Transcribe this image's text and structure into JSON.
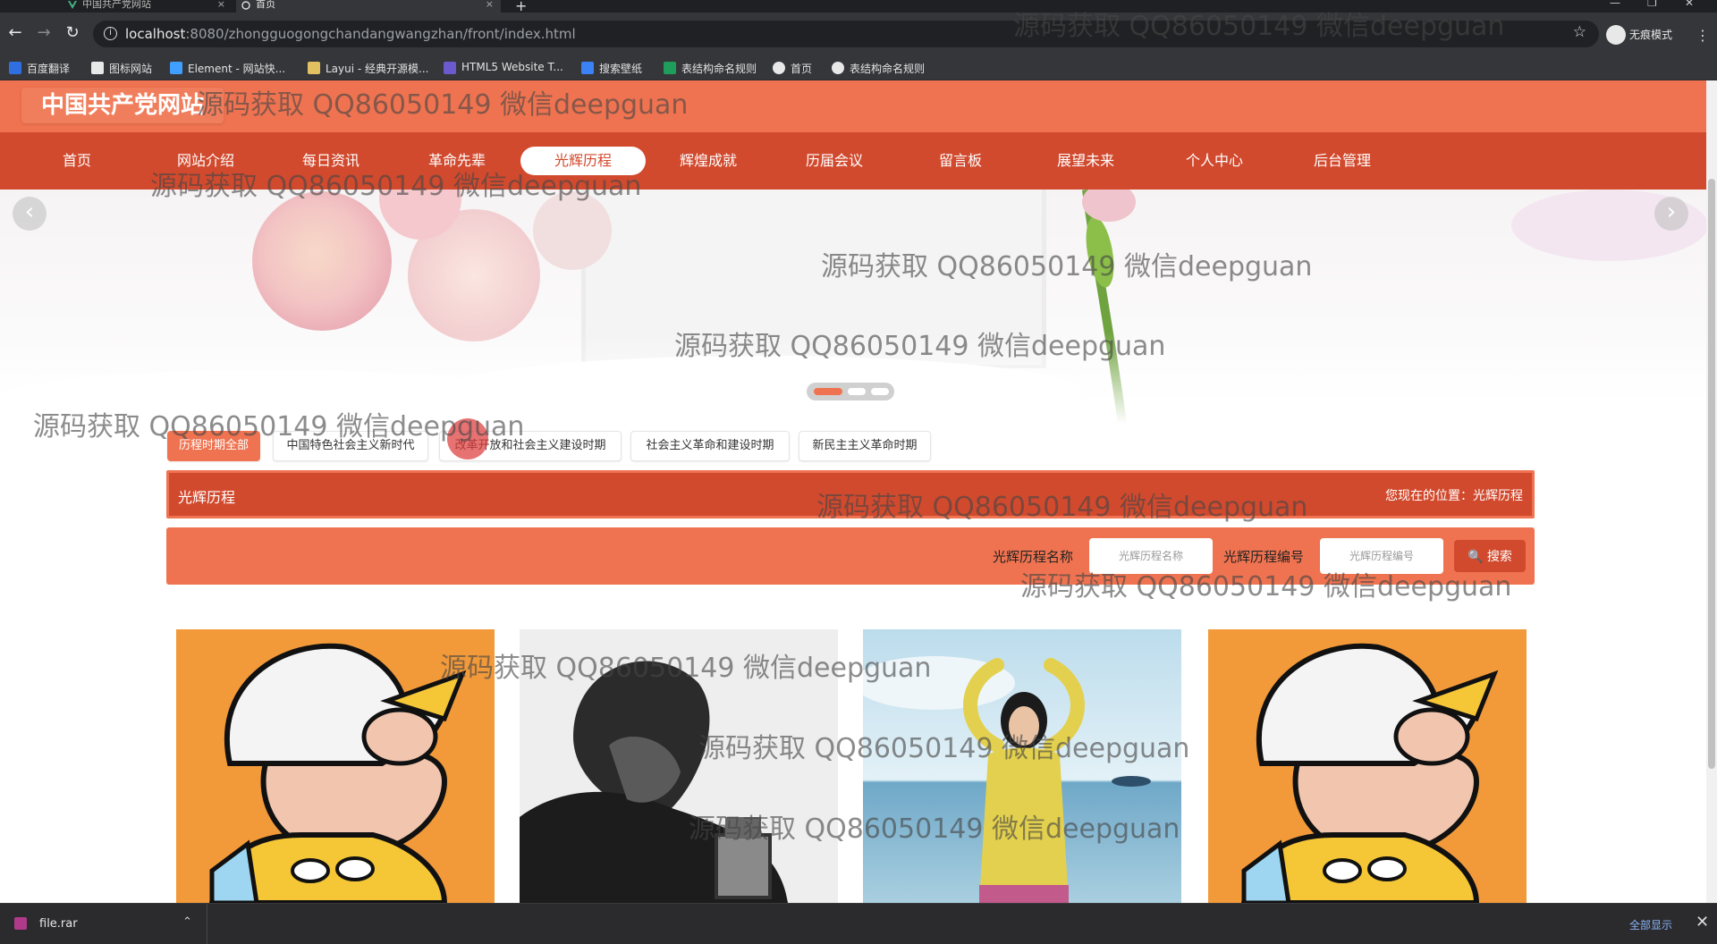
{
  "browser": {
    "tabs": [
      {
        "title": "中国共产党网站",
        "close": "×"
      },
      {
        "title": "首页",
        "close": "×"
      }
    ],
    "new_tab": "+",
    "url_host": "localhost",
    "url_path": ":8080/zhongguogongchandangwangzhan/front/index.html",
    "profile_label": "无痕模式",
    "bookmarks": [
      {
        "label": "百度翻译",
        "icon": "baidu-translate-icon",
        "color": "#2f6fe0"
      },
      {
        "label": "图标网站",
        "icon": "flag-icon",
        "color": "#e8e8e8"
      },
      {
        "label": "Element - 网站快...",
        "icon": "element-icon",
        "color": "#409eff"
      },
      {
        "label": "Layui - 经典开源模...",
        "icon": "layui-icon",
        "color": "#e0c060"
      },
      {
        "label": "HTML5 Website T...",
        "icon": "html5-template-icon",
        "color": "#6a5acd"
      },
      {
        "label": "搜索壁纸",
        "icon": "wallpaper-search-icon",
        "color": "#3b82f6"
      },
      {
        "label": "表结构命名规则",
        "icon": "sheet-icon",
        "color": "#1e9e5a"
      },
      {
        "label": "首页",
        "icon": "globe-icon",
        "color": "#e8e8e8"
      },
      {
        "label": "表结构命名规则",
        "icon": "globe-icon",
        "color": "#e8e8e8"
      }
    ],
    "downloads": {
      "file": "file.rar",
      "show_all": "全部显示",
      "close": "✕"
    }
  },
  "site": {
    "title": "中国共产党网站",
    "nav": [
      {
        "label": "首页",
        "active": false
      },
      {
        "label": "网站介绍",
        "active": false
      },
      {
        "label": "每日资讯",
        "active": false
      },
      {
        "label": "革命先辈",
        "active": false
      },
      {
        "label": "光辉历程",
        "active": true
      },
      {
        "label": "辉煌成就",
        "active": false
      },
      {
        "label": "历届会议",
        "active": false
      },
      {
        "label": "留言板",
        "active": false
      },
      {
        "label": "展望未来",
        "active": false
      },
      {
        "label": "个人中心",
        "active": false
      },
      {
        "label": "后台管理",
        "active": false
      }
    ],
    "carousel": {
      "prev": "‹",
      "next": "›",
      "slides": 3,
      "active_slide": 1
    },
    "filters": [
      {
        "label": "历程时期全部",
        "active": true
      },
      {
        "label": "中国特色社会主义新时代",
        "active": false
      },
      {
        "label": "改革开放和社会主义建设时期",
        "active": false
      },
      {
        "label": "社会主义革命和建设时期",
        "active": false
      },
      {
        "label": "新民主主义革命时期",
        "active": false
      }
    ],
    "section": {
      "title": "光辉历程",
      "breadcrumb": "您现在的位置：光辉历程"
    },
    "search": {
      "name_label": "光辉历程名称",
      "name_placeholder": "光辉历程名称",
      "code_label": "光辉历程编号",
      "code_placeholder": "光辉历程编号",
      "button": "🔍 搜索"
    },
    "cards": [
      {
        "image": "cartoon-boy-image"
      },
      {
        "image": "man-portrait-image"
      },
      {
        "image": "girl-beach-image"
      },
      {
        "image": "cartoon-boy-image"
      }
    ]
  },
  "watermark": "源码获取 QQ86050149 微信deepguan",
  "colors": {
    "header": "#ef7350",
    "nav": "#d24a2e",
    "accent": "#ef7350"
  }
}
